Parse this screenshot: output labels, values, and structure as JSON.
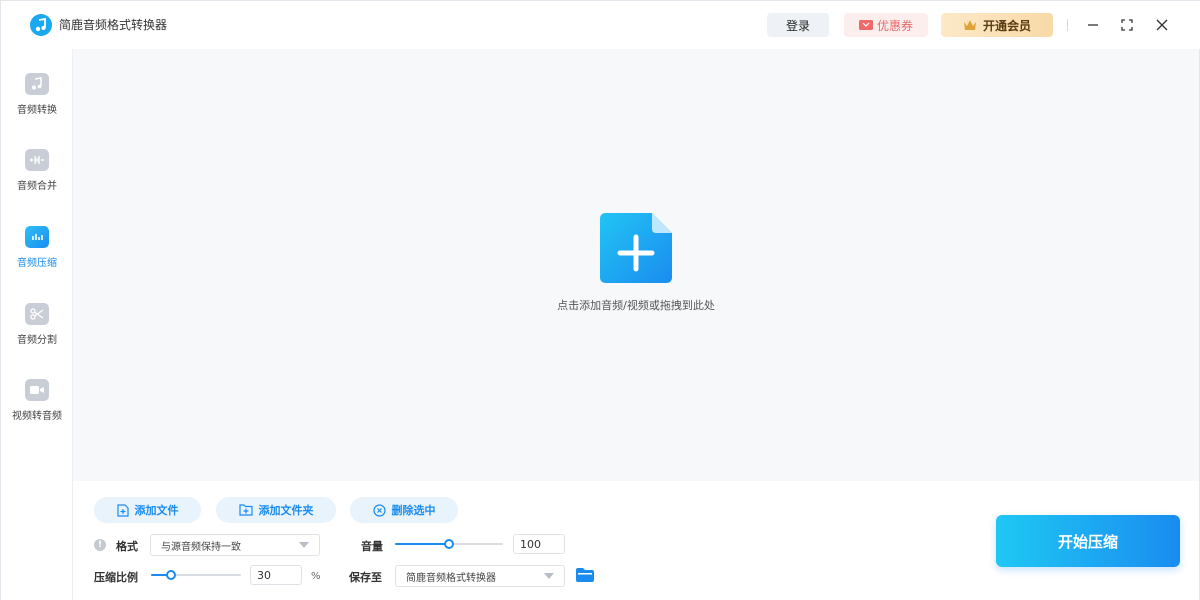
{
  "app": {
    "title": "简鹿音频格式转换器"
  },
  "header": {
    "login_label": "登录",
    "coupon_label": "优惠券",
    "vip_label": "开通会员"
  },
  "sidebar": {
    "items": [
      {
        "label": "音频转换",
        "icon": "music-note-icon",
        "active": false
      },
      {
        "label": "音频合并",
        "icon": "merge-icon",
        "active": false
      },
      {
        "label": "音频压缩",
        "icon": "compress-icon",
        "active": true
      },
      {
        "label": "音频分割",
        "icon": "scissors-icon",
        "active": false
      },
      {
        "label": "视频转音频",
        "icon": "video-icon",
        "active": false
      }
    ]
  },
  "dropzone": {
    "hint": "点击添加音频/视频或拖拽到此处"
  },
  "toolbar": {
    "add_file": "添加文件",
    "add_folder": "添加文件夹",
    "delete_selected": "删除选中"
  },
  "settings": {
    "format_label": "格式",
    "format_value": "与源音频保持一致",
    "volume_label": "音量",
    "volume_value": "100",
    "volume_fraction": 0.5,
    "ratio_label": "压缩比例",
    "ratio_value": "30",
    "ratio_fraction": 0.22,
    "ratio_unit": "%",
    "save_label": "保存至",
    "save_value": "简鹿音频格式转换器"
  },
  "actions": {
    "start_label": "开始压缩"
  },
  "colors": {
    "accent": "#1a8cf0",
    "accent_light": "#1fc8f3"
  }
}
